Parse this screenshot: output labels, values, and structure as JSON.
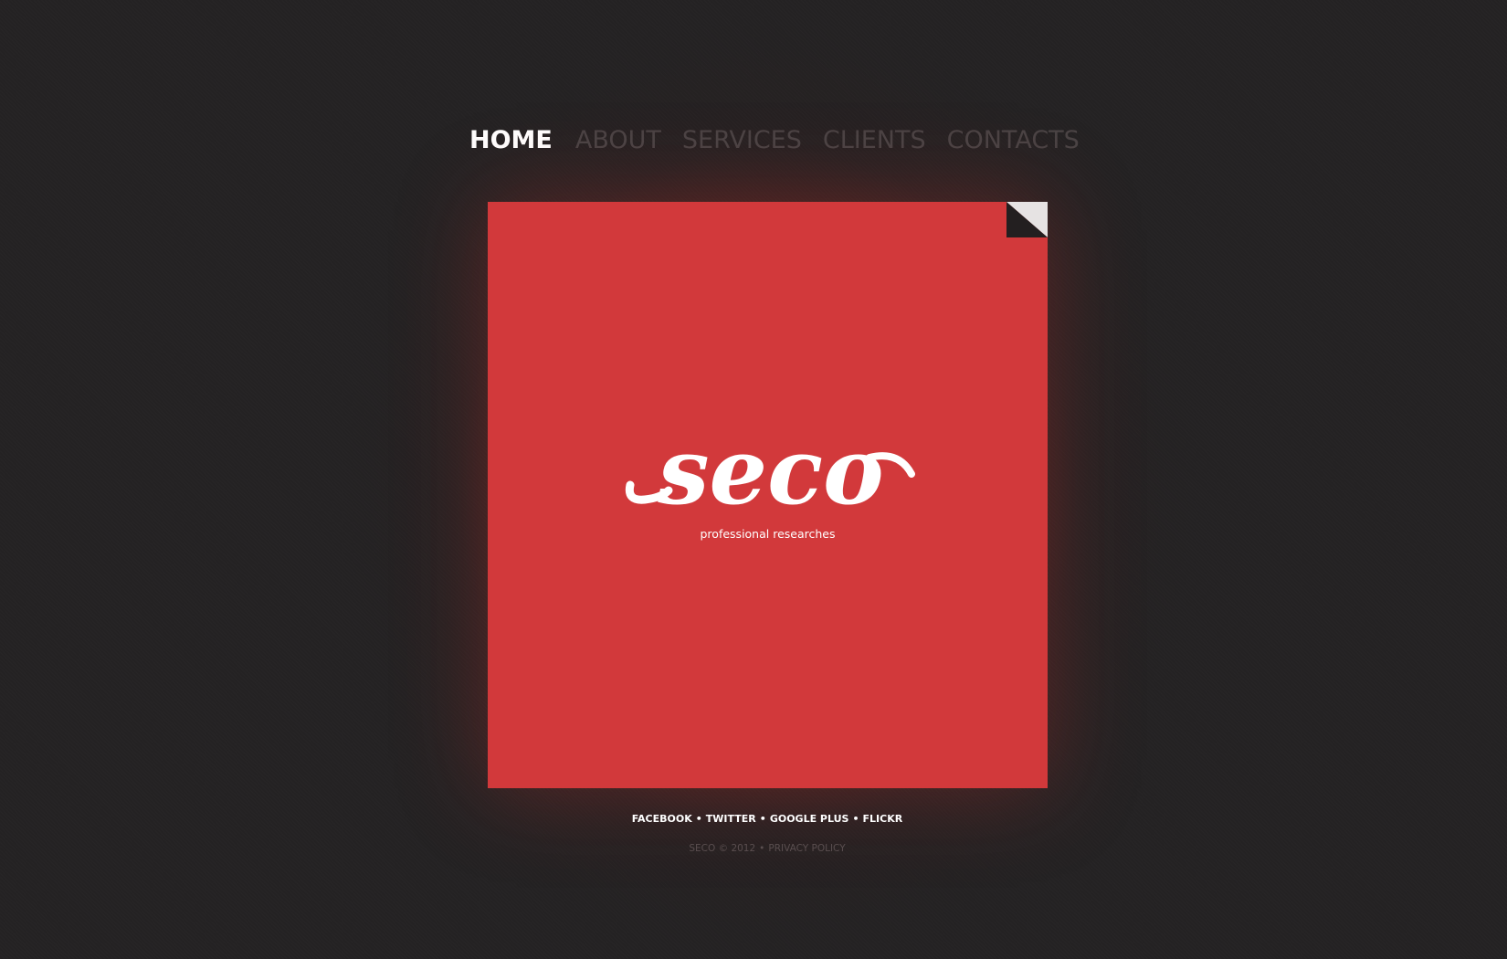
{
  "nav": {
    "items": [
      {
        "label": "HOME",
        "active": true
      },
      {
        "label": "ABOUT",
        "active": false
      },
      {
        "label": "SERVICES",
        "active": false
      },
      {
        "label": "CLIENTS",
        "active": false
      },
      {
        "label": "CONTACTS",
        "active": false
      }
    ]
  },
  "hero": {
    "logo_text": "seco",
    "tagline": "professional researches",
    "accent_color": "#d2393b",
    "corner_icon": "page-curl-icon"
  },
  "footer": {
    "social": [
      "FACEBOOK",
      "TWITTER",
      "GOOGLE PLUS",
      "FLICKR"
    ],
    "separator": "•",
    "copyright": "SECO © 2012",
    "privacy": "PRIVACY POLICY"
  },
  "colors": {
    "background": "#242223",
    "nav_active": "#ffffff",
    "nav_inactive": "#4a4445"
  }
}
